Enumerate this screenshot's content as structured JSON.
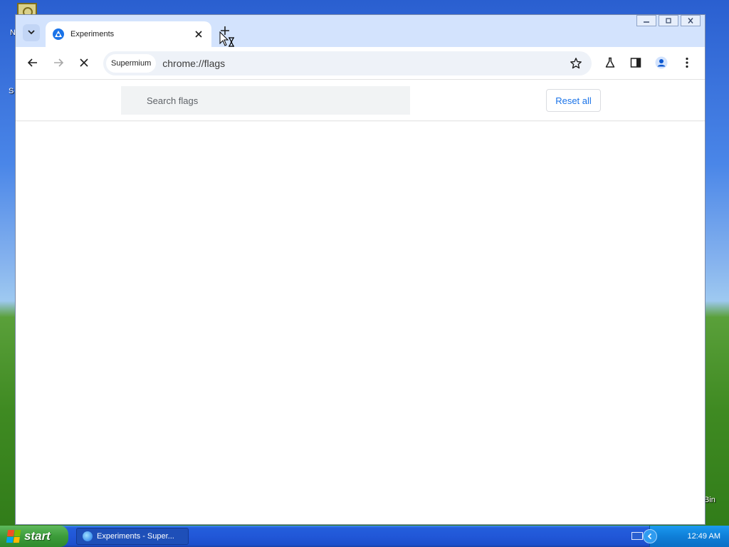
{
  "browser": {
    "tab_title": "Experiments",
    "chip_label": "Supermium",
    "url": "chrome://flags",
    "icons": {
      "tab_search": "chevron-down-icon",
      "favicon": "flags-favicon",
      "close": "close-icon",
      "new_tab": "plus-icon",
      "back": "back-arrow-icon",
      "forward": "forward-arrow-icon",
      "stop": "stop-icon",
      "bookmark": "star-icon",
      "labs": "flask-icon",
      "side_panel": "side-panel-icon",
      "profile": "profile-icon",
      "menu": "kebab-menu-icon"
    }
  },
  "flags_page": {
    "search_placeholder": "Search flags",
    "reset_label": "Reset all"
  },
  "taskbar": {
    "start_label": "start",
    "task_label": "Experiments - Super...",
    "clock": "12:49 AM"
  },
  "colors": {
    "tabstrip_bg": "#d3e3fd",
    "accent": "#1a73e8",
    "taskbar_blue": "#245edb",
    "start_green": "#3c9c3a"
  }
}
